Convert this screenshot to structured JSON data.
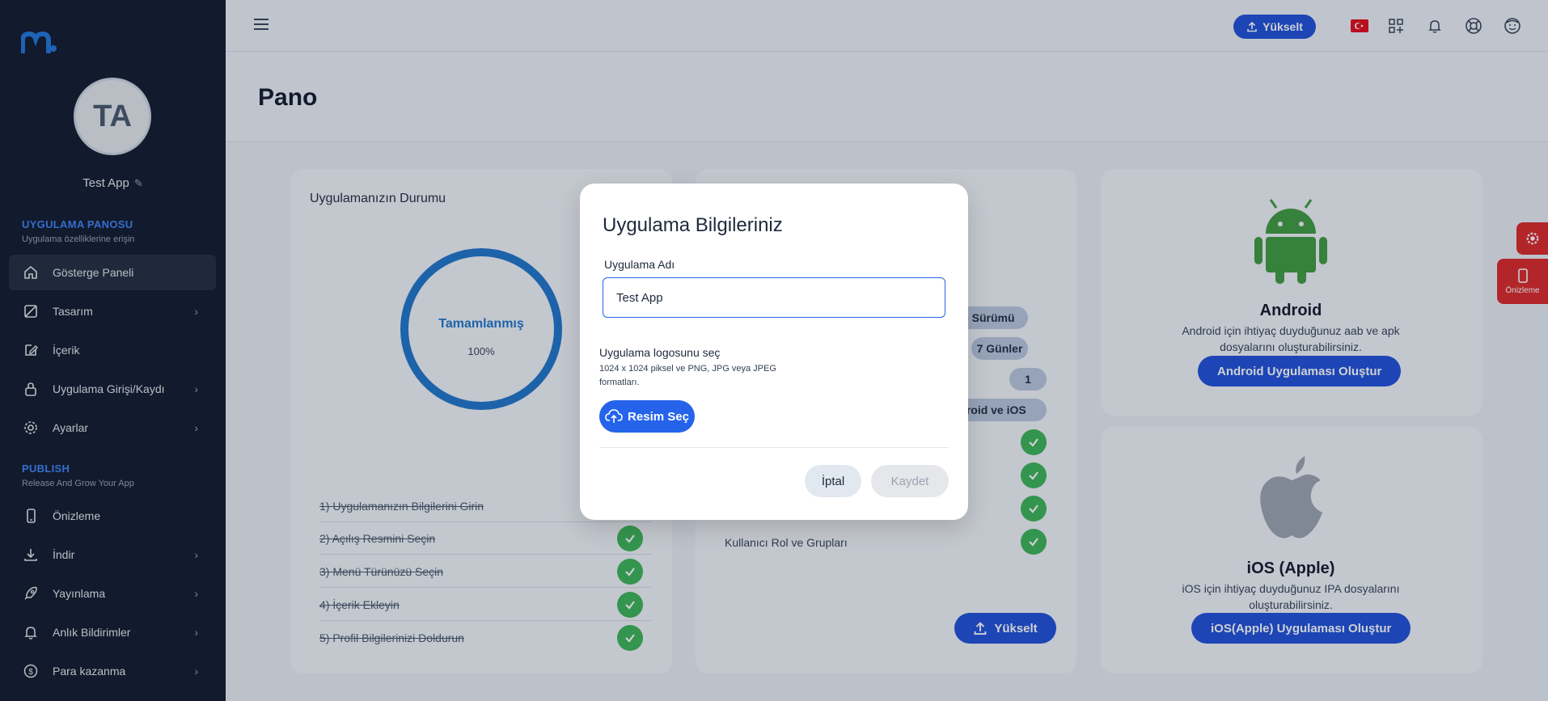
{
  "sidebar": {
    "avatar_initials": "TA",
    "app_name": "Test App",
    "section_app": {
      "title": "UYGULAMA PANOSU",
      "subtitle": "Uygulama özelliklerine erişin"
    },
    "section_publish": {
      "title": "PUBLISH",
      "subtitle": "Release And Grow Your App"
    },
    "items": [
      {
        "label": "Gösterge Paneli",
        "icon": "home-icon",
        "active": true
      },
      {
        "label": "Tasarım",
        "icon": "design-icon"
      },
      {
        "label": "İçerik",
        "icon": "edit-icon"
      },
      {
        "label": "Uygulama Girişi/Kaydı",
        "icon": "lock-icon"
      },
      {
        "label": "Ayarlar",
        "icon": "gear-icon"
      },
      {
        "label": "Önizleme",
        "icon": "phone-icon"
      },
      {
        "label": "İndir",
        "icon": "download-icon"
      },
      {
        "label": "Yayınlama",
        "icon": "rocket-icon"
      },
      {
        "label": "Anlık Bildirimler",
        "icon": "bell-icon"
      },
      {
        "label": "Para kazanma",
        "icon": "dollar-icon"
      }
    ]
  },
  "header": {
    "upgrade_label": "Yükselt",
    "page_title": "Pano"
  },
  "status_card": {
    "title": "Uygulamanızın Durumu",
    "ring_label": "Tamamlanmış",
    "ring_percent": "100%",
    "steps": [
      "1) Uygulamanızın Bilgilerini Girin",
      "2) Açılış Resmini Seçin",
      "3) Menü Türünüzü Seçin",
      "4) İçerik Ekleyin",
      "5) Profil Bilgilerinizi Doldurun"
    ]
  },
  "plan_card": {
    "pills": [
      "me Sürümü",
      "7 Günler",
      "1",
      "droid ve iOS"
    ],
    "feature_last": "Kullanıcı Rol ve Grupları",
    "upgrade_label": "Yükselt"
  },
  "android_card": {
    "title": "Android",
    "desc": "Android için ihtiyaç duyduğunuz aab ve apk dosyalarını oluşturabilirsiniz.",
    "button": "Android Uygulaması Oluştur"
  },
  "ios_card": {
    "title": "iOS (Apple)",
    "desc": "iOS için ihtiyaç duyduğunuz IPA dosyalarını oluşturabilirsiniz.",
    "button": "iOS(Apple) Uygulaması Oluştur"
  },
  "floating": {
    "preview_label": "Önizleme"
  },
  "modal": {
    "title": "Uygulama Bilgileriniz",
    "name_label": "Uygulama Adı",
    "name_value": "Test App",
    "logo_label": "Uygulama logosunu seç",
    "logo_hint": "1024 x 1024 piksel ve PNG, JPG veya JPEG formatları.",
    "choose_button": "Resim Seç",
    "cancel_button": "İptal",
    "save_button": "Kaydet"
  },
  "colors": {
    "sidebar_bg": "#0f1729",
    "accent_blue": "#1d4ed8",
    "success_green": "#3ab454",
    "danger_red": "#dc2626"
  }
}
